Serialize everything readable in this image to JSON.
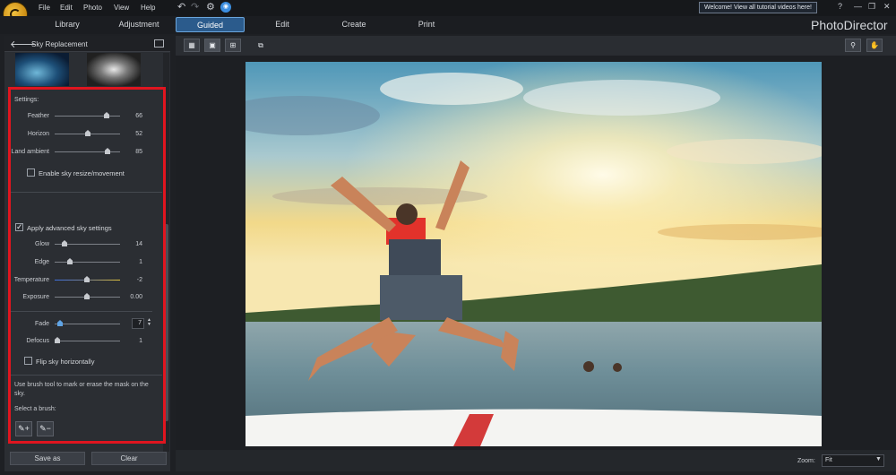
{
  "menu": {
    "items": [
      "File",
      "Edit",
      "Photo",
      "View",
      "Help"
    ],
    "welcome": "Welcome! View all tutorial videos here!",
    "window_controls": [
      "?",
      "—",
      "❐",
      "✕"
    ]
  },
  "modes": {
    "tabs": [
      "Library",
      "Adjustment",
      "Guided",
      "Edit",
      "Create",
      "Print"
    ],
    "active": "Guided"
  },
  "brand": "PhotoDirector",
  "panel": {
    "title": "Sky Replacement",
    "settings_heading": "Settings:",
    "sliders_basic": [
      {
        "label": "Feather",
        "value": "66",
        "fraction": 0.85
      },
      {
        "label": "Horizon",
        "value": "52",
        "fraction": 0.52
      },
      {
        "label": "Land ambient",
        "value": "85",
        "fraction": 0.85
      }
    ],
    "enable_resize": {
      "label": "Enable sky resize/movement",
      "checked": false
    },
    "advanced": {
      "label": "Apply advanced sky settings",
      "checked": true
    },
    "sliders_advanced": [
      {
        "label": "Glow",
        "value": "14",
        "fraction": 0.14
      },
      {
        "label": "Edge",
        "value": "1",
        "fraction": 0.2
      },
      {
        "label": "Temperature",
        "value": "-2",
        "fraction": 0.48
      },
      {
        "label": "Exposure",
        "value": "0.00",
        "fraction": 0.5
      }
    ],
    "fade": {
      "label": "Fade",
      "value": "7",
      "fraction": 0.07
    },
    "defocus": {
      "label": "Defocus",
      "value": "1",
      "fraction": 0.02
    },
    "flip": {
      "label": "Flip sky horizontally",
      "checked": false
    },
    "brush_note": "Use brush tool to mark or erase the mask on the sky.",
    "brush_label": "Select a brush:",
    "save_as": "Save as",
    "clear": "Clear"
  },
  "status": {
    "zoom_label": "Zoom:",
    "zoom_value": "Fit"
  },
  "colors": {
    "highlight": "#e0151f",
    "active_tab": "#2b5b8c"
  }
}
